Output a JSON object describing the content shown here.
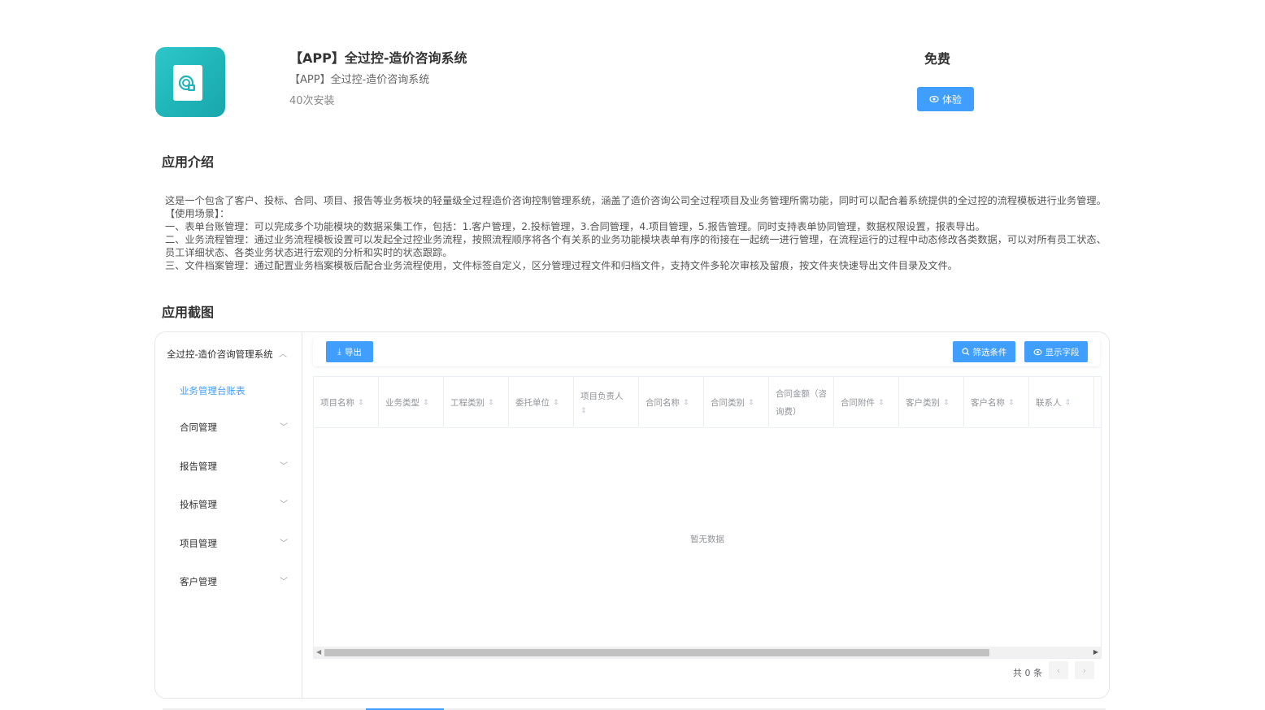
{
  "app": {
    "title": "【APP】全过控-造价咨询系统",
    "subtitle": "【APP】全过控-造价咨询系统",
    "installs": "40次安装",
    "price": "免费",
    "try_label": "体验",
    "icon_color": "#22bcc0"
  },
  "intro": {
    "heading": "应用介绍",
    "lines": [
      "这是一个包含了客户、投标、合同、项目、报告等业务板块的轻量级全过程造价咨询控制管理系统，涵盖了造价咨询公司全过程项目及业务管理所需功能，同时可以配合着系统提供的全过控的流程模板进行业务管理。",
      "【使用场景】：",
      "一、表单台账管理：可以完成多个功能模块的数据采集工作，包括：1.客户管理，2.投标管理，3.合同管理，4.项目管理，5.报告管理。同时支持表单协同管理，数据权限设置，报表导出。",
      "二、业务流程管理：通过业务流程模板设置可以发起全过控业务流程，按照流程顺序将各个有关系的业务功能模块表单有序的衔接在一起统一进行管理，在流程运行的过程中动态修改各类数据，可以对所有员工状态、员工详细状态、各类业务状态进行宏观的分析和实时的状态跟踪。",
      "三、文件档案管理：通过配置业务档案模板后配合业务流程使用，文件标签自定义，区分管理过程文件和归档文件，支持文件多轮次审核及留痕，按文件夹快速导出文件目录及文件。"
    ]
  },
  "screenshots": {
    "heading": "应用截图"
  },
  "shot": {
    "sidebar_title": "全过控-造价咨询管理系统",
    "active_item": "业务管理台账表",
    "items": [
      "合同管理",
      "报告管理",
      "投标管理",
      "项目管理",
      "客户管理"
    ],
    "export_label": "导出",
    "filter_label": "筛选条件",
    "fields_label": "显示字段",
    "columns": [
      "项目名称",
      "业务类型",
      "工程类别",
      "委托单位",
      "项目负责人",
      "合同名称",
      "合同类别",
      "合同金额（咨询费）",
      "合同附件",
      "客户类别",
      "客户名称",
      "联系人"
    ],
    "empty_text": "暂无数据",
    "total_text": "共 0 条",
    "accent_color": "#409eff"
  }
}
